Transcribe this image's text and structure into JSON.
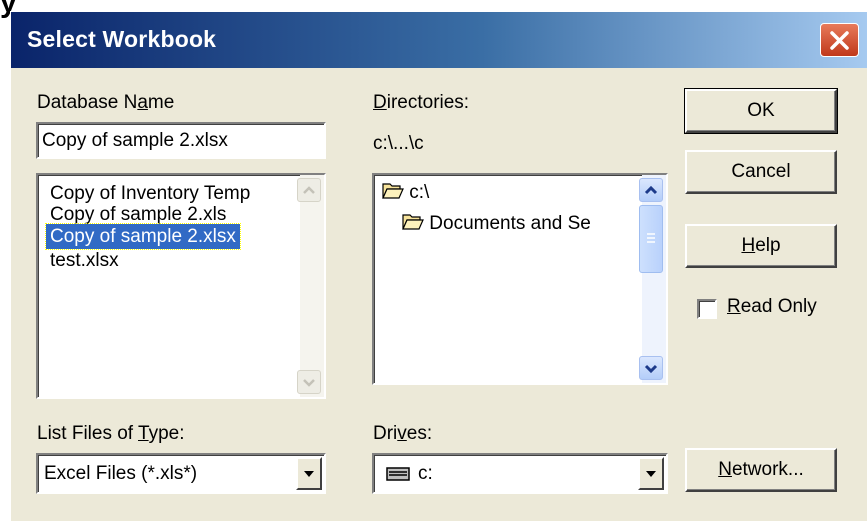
{
  "window": {
    "title": "Select Workbook"
  },
  "database": {
    "label_pre": "Database N",
    "label_u": "a",
    "label_post": "me",
    "value": "Copy of sample 2.xlsx",
    "files": [
      "Copy of Inventory Temp",
      "Copy of sample 2.xls",
      "Copy of sample 2.xlsx",
      "test.xlsx"
    ],
    "selected_index": 2
  },
  "directories": {
    "label_u": "D",
    "label_post": "irectories:",
    "path": "c:\\...\\c",
    "items": [
      "c:\\",
      "Documents and Se"
    ]
  },
  "filetype": {
    "label_pre": "List Files of ",
    "label_u": "T",
    "label_post": "ype:",
    "value": "Excel Files (*.xls*)"
  },
  "drives": {
    "label_pre": "Dri",
    "label_u": "v",
    "label_post": "es:",
    "value": "c:"
  },
  "buttons": {
    "ok": "OK",
    "cancel": "Cancel",
    "help_u": "H",
    "help_post": "elp",
    "network_u": "N",
    "network_post": "etwork..."
  },
  "read_only": {
    "label_u": "R",
    "label_post": "ead Only",
    "checked": false
  },
  "colors": {
    "title_bar_start": "#0a246a",
    "title_bar_end": "#a6caf0",
    "dialog_bg": "#ece9d8",
    "selection": "#316ac5"
  }
}
